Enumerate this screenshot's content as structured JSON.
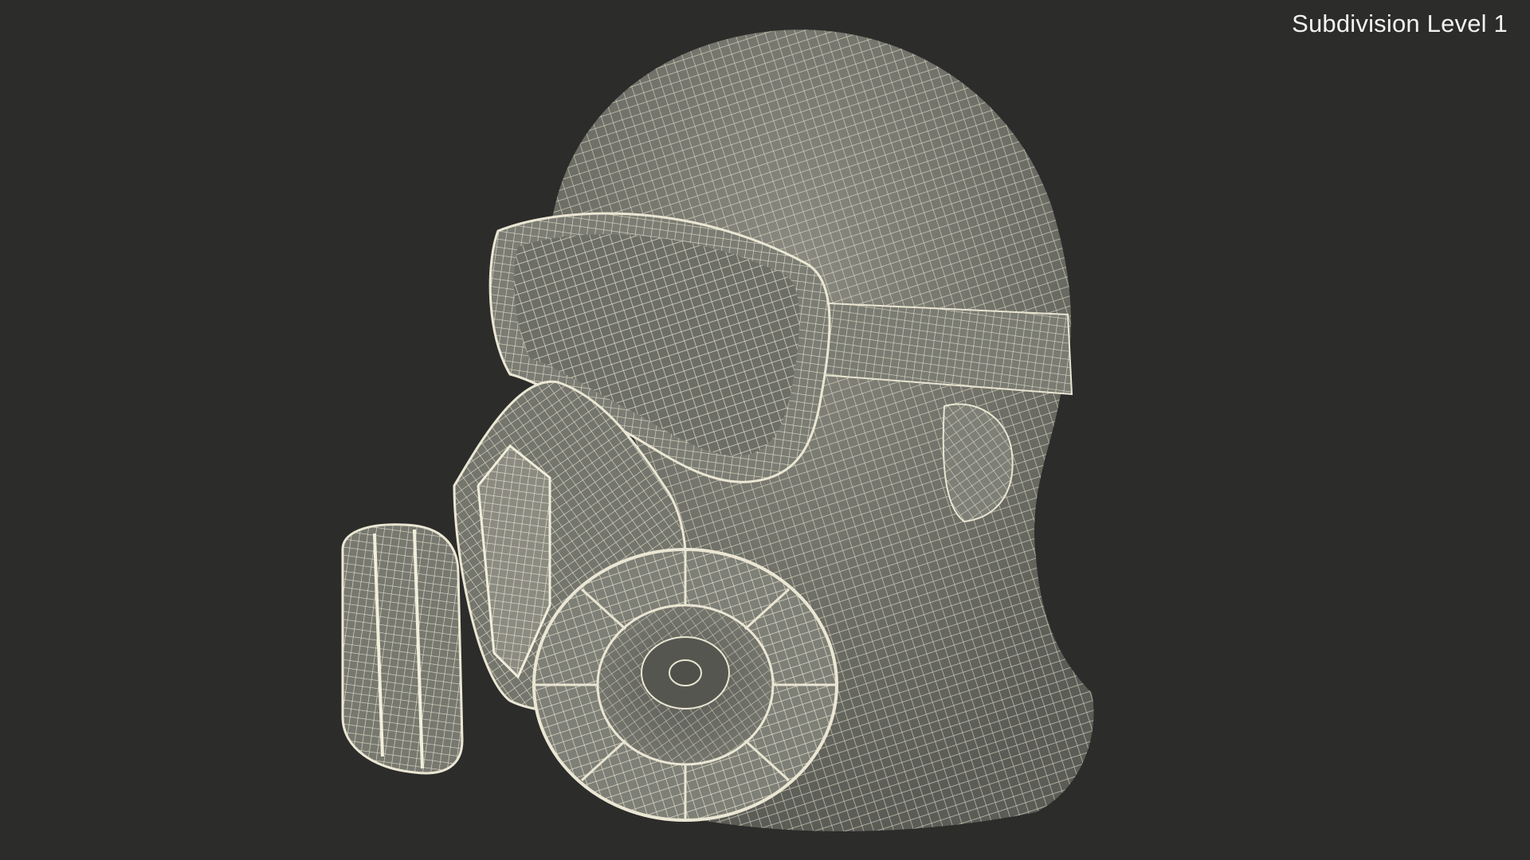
{
  "viewport": {
    "label": "Subdivision Level 1",
    "background_color": "#2c2c2b",
    "model_fill_color": "#6f7067",
    "wire_color": "#e9e5d2"
  }
}
